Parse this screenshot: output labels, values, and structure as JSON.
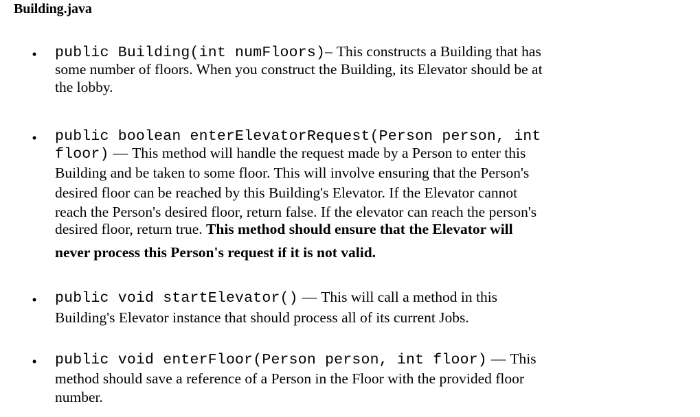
{
  "document": {
    "title": "Building.java",
    "bullet_glyph": "•"
  },
  "methods": [
    {
      "id": "constructor-building",
      "signature": "public Building(int numFloors)",
      "dash": "–",
      "description": "This constructs a Building that has some number of floors. When you construct the Building, its Elevator should be at the lobby.",
      "lines": [
        {
          "mono": "public Building(int numFloors)",
          "dash": "–",
          "text": "This constructs a Building that has"
        },
        {
          "mono": "",
          "dash": "",
          "text": "some number of floors. When you construct the Building, its Elevator should be at"
        },
        {
          "mono": "",
          "dash": "",
          "text": "the lobby."
        }
      ]
    },
    {
      "id": "enter-elevator-request",
      "signature": "public boolean enterElevatorRequest(Person person, int floor)",
      "dash": "—",
      "description": "This method will handle the request made by a Person to enter this Building and be taken to some floor. This will involve ensuring that the Person's desired floor can be reached by this Building's Elevator. If the Elevator cannot reach the Person's desired floor, return false. If the elevator can reach the person's desired floor, return true.",
      "bold_description": "This method should ensure that the Elevator will never process this Person's request if it is not valid.",
      "lines": [
        {
          "mono": "public boolean enterElevatorRequest(Person person, int",
          "dash": "",
          "text": ""
        },
        {
          "mono": "floor)",
          "dash": "—",
          "text": "This method will handle the request made by a Person to enter this"
        },
        {
          "mono": "",
          "dash": "",
          "text": "Building and be taken to some floor. This will involve ensuring that the Person's"
        },
        {
          "mono": "",
          "dash": "",
          "text": "desired floor can be reached by this Building's Elevator. If the Elevator cannot"
        },
        {
          "mono": "",
          "dash": "",
          "text": "reach the Person's desired floor, return false. If the elevator can reach the person's"
        },
        {
          "mono": "",
          "dash": "",
          "text": "desired floor, return true. ",
          "bold": "This method should ensure that the Elevator will"
        },
        {
          "mono": "",
          "dash": "",
          "text": "",
          "bold": "never process this Person's request if it is not valid."
        }
      ]
    },
    {
      "id": "start-elevator",
      "signature": "public void startElevator()",
      "dash": "—",
      "description": "This will call a method in this Building's Elevator instance that should process all of its current Jobs.",
      "lines": [
        {
          "mono": "public void startElevator()",
          "dash": "—",
          "text": "This will call a method in this"
        },
        {
          "mono": "",
          "dash": "",
          "text": "Building's Elevator instance that should process all of its current Jobs."
        }
      ]
    },
    {
      "id": "enter-floor",
      "signature": "public void enterFloor(Person person, int floor)",
      "dash": "—",
      "description": "This method should save a reference of a Person in the Floor with the provided floor number.",
      "lines": [
        {
          "mono": "public void enterFloor(Person person, int floor)",
          "dash": "—",
          "text": "This"
        },
        {
          "mono": "",
          "dash": "",
          "text": "method should save a reference of a Person in the Floor with the provided floor"
        },
        {
          "mono": "",
          "dash": "",
          "text": "number."
        }
      ]
    }
  ]
}
